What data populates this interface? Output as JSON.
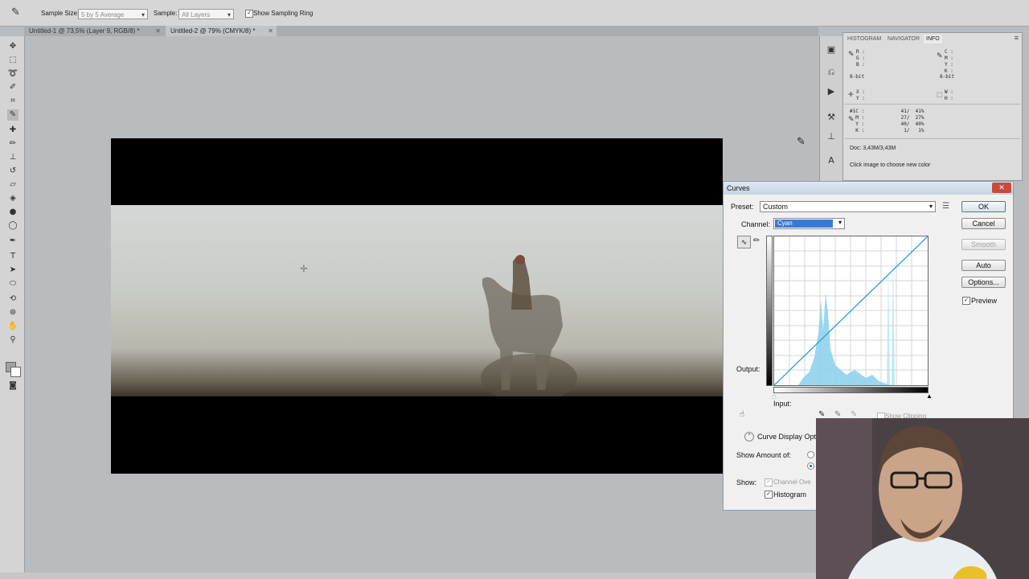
{
  "options_bar": {
    "sample_size_label": "Sample Size:",
    "sample_size_value": "5 by 5 Average",
    "sample_label": "Sample:",
    "sample_value": "All Layers",
    "show_sampling_ring_label": "Show Sampling Ring",
    "show_sampling_ring_checked": true
  },
  "tabs": [
    {
      "label": "Untitled-1 @ 73,5% (Layer 9, RGB/8) *",
      "active": false
    },
    {
      "label": "Untitled-2 @ 79% (CMYK/8) *",
      "active": true
    }
  ],
  "panel": {
    "tabs": [
      "HISTOGRAM",
      "NAVIGATOR",
      "INFO"
    ],
    "active_tab": "INFO",
    "rgb_lines": "R :\nG :\nB :",
    "rgb_bit": "8-bit",
    "cmyk_lines": "C :\nM :\nY :\nK :",
    "cmyk_bit": "8-bit",
    "xy_lines": "X :\nY :",
    "wh_lines": "W :\nH :",
    "sampler_lines": "#1C :\n  M :\n  Y :\n  K :",
    "sampler_values": " 41/  41%\n 27/  27%\n 40/  40%\n  1/   1%",
    "doc_size": "Doc: 3,43M/3,43M",
    "hint": "Click image to choose new color"
  },
  "curves": {
    "title": "Curves",
    "preset_label": "Preset:",
    "preset_value": "Custom",
    "channel_label": "Channel:",
    "channel_value": "Cyan",
    "output_label": "Output:",
    "input_label": "Input:",
    "buttons": {
      "ok": "OK",
      "cancel": "Cancel",
      "smooth": "Smooth",
      "auto": "Auto",
      "options": "Options..."
    },
    "preview_label": "Preview",
    "preview_checked": true,
    "show_clipping_label": "Show Clipping",
    "curve_display_label": "Curve Display Opt",
    "show_amount_label": "Show Amount of:",
    "show_label": "Show:",
    "channel_overlays_label": "Channel Ove",
    "histogram_label": "Histogram",
    "close_glyph": "✕"
  },
  "colors": {
    "curve_line": "#2b9fd6",
    "histogram": "#8fd3ec",
    "channel_highlight": "#3a78d8"
  }
}
